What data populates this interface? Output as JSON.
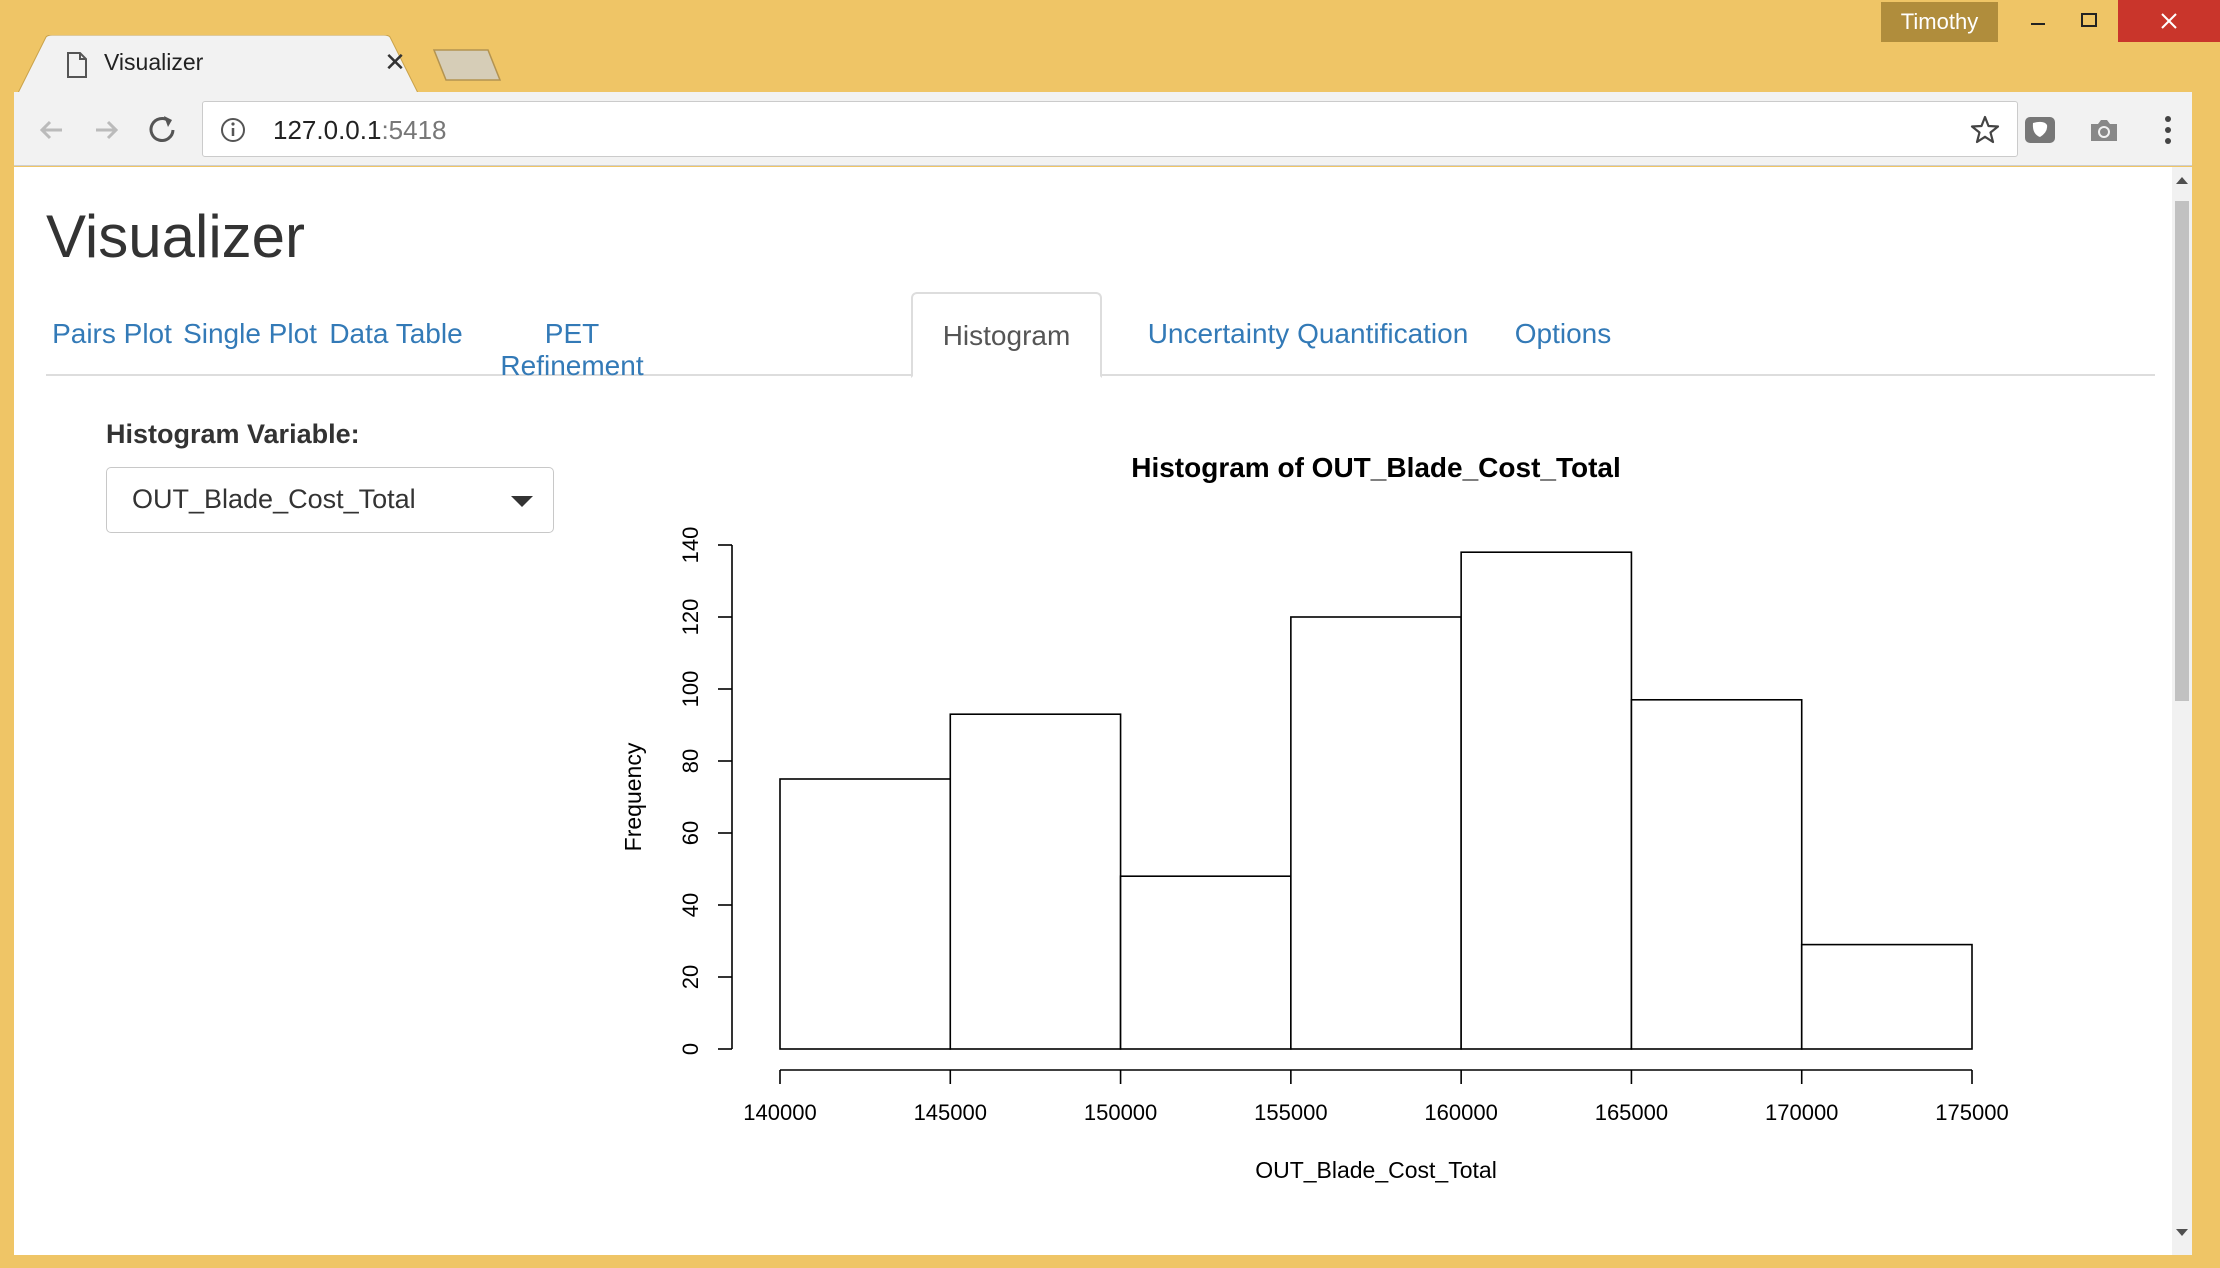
{
  "browser": {
    "tab_title": "Visualizer",
    "profile_name": "Timothy",
    "url_host": "127.0.0.1",
    "url_port": ":5418"
  },
  "page": {
    "title": "Visualizer",
    "tabs": [
      {
        "label": "Pairs Plot",
        "active": false
      },
      {
        "label": "Single Plot",
        "active": false
      },
      {
        "label": "Data Table",
        "active": false
      },
      {
        "label": "PET Refinement",
        "active": false
      },
      {
        "label": "Histogram",
        "active": true
      },
      {
        "label": "Uncertainty Quantification",
        "active": false
      },
      {
        "label": "Options",
        "active": false
      }
    ],
    "histogram_variable_label": "Histogram Variable:",
    "histogram_variable_value": "OUT_Blade_Cost_Total"
  },
  "chart_data": {
    "type": "bar",
    "title": "Histogram of OUT_Blade_Cost_Total",
    "xlabel": "OUT_Blade_Cost_Total",
    "ylabel": "Frequency",
    "bin_edges": [
      140000,
      145000,
      150000,
      155000,
      160000,
      165000,
      170000,
      175000
    ],
    "values": [
      75,
      93,
      48,
      120,
      138,
      97,
      29
    ],
    "xlim": [
      140000,
      175000
    ],
    "ylim": [
      0,
      140
    ],
    "xticks": [
      "140000",
      "145000",
      "150000",
      "155000",
      "160000",
      "165000",
      "170000",
      "175000"
    ],
    "yticks": [
      "0",
      "20",
      "40",
      "60",
      "80",
      "100",
      "120",
      "140"
    ],
    "bar_fill": "#ffffff",
    "bar_stroke": "#000000",
    "grid": false
  }
}
